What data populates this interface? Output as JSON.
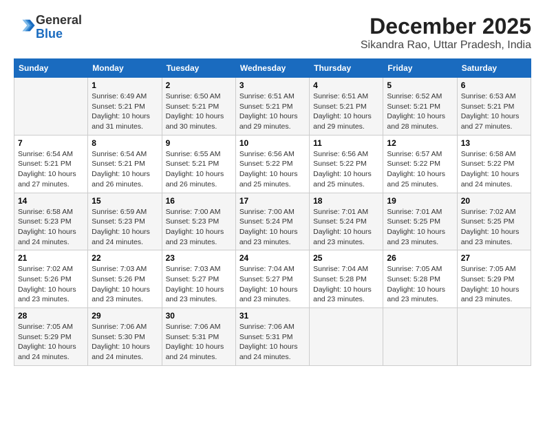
{
  "header": {
    "logo_line1": "General",
    "logo_line2": "Blue",
    "month_year": "December 2025",
    "location": "Sikandra Rao, Uttar Pradesh, India"
  },
  "days_of_week": [
    "Sunday",
    "Monday",
    "Tuesday",
    "Wednesday",
    "Thursday",
    "Friday",
    "Saturday"
  ],
  "weeks": [
    [
      {
        "day": "",
        "sunrise": "",
        "sunset": "",
        "daylight": ""
      },
      {
        "day": "1",
        "sunrise": "Sunrise: 6:49 AM",
        "sunset": "Sunset: 5:21 PM",
        "daylight": "Daylight: 10 hours and 31 minutes."
      },
      {
        "day": "2",
        "sunrise": "Sunrise: 6:50 AM",
        "sunset": "Sunset: 5:21 PM",
        "daylight": "Daylight: 10 hours and 30 minutes."
      },
      {
        "day": "3",
        "sunrise": "Sunrise: 6:51 AM",
        "sunset": "Sunset: 5:21 PM",
        "daylight": "Daylight: 10 hours and 29 minutes."
      },
      {
        "day": "4",
        "sunrise": "Sunrise: 6:51 AM",
        "sunset": "Sunset: 5:21 PM",
        "daylight": "Daylight: 10 hours and 29 minutes."
      },
      {
        "day": "5",
        "sunrise": "Sunrise: 6:52 AM",
        "sunset": "Sunset: 5:21 PM",
        "daylight": "Daylight: 10 hours and 28 minutes."
      },
      {
        "day": "6",
        "sunrise": "Sunrise: 6:53 AM",
        "sunset": "Sunset: 5:21 PM",
        "daylight": "Daylight: 10 hours and 27 minutes."
      }
    ],
    [
      {
        "day": "7",
        "sunrise": "Sunrise: 6:54 AM",
        "sunset": "Sunset: 5:21 PM",
        "daylight": "Daylight: 10 hours and 27 minutes."
      },
      {
        "day": "8",
        "sunrise": "Sunrise: 6:54 AM",
        "sunset": "Sunset: 5:21 PM",
        "daylight": "Daylight: 10 hours and 26 minutes."
      },
      {
        "day": "9",
        "sunrise": "Sunrise: 6:55 AM",
        "sunset": "Sunset: 5:21 PM",
        "daylight": "Daylight: 10 hours and 26 minutes."
      },
      {
        "day": "10",
        "sunrise": "Sunrise: 6:56 AM",
        "sunset": "Sunset: 5:22 PM",
        "daylight": "Daylight: 10 hours and 25 minutes."
      },
      {
        "day": "11",
        "sunrise": "Sunrise: 6:56 AM",
        "sunset": "Sunset: 5:22 PM",
        "daylight": "Daylight: 10 hours and 25 minutes."
      },
      {
        "day": "12",
        "sunrise": "Sunrise: 6:57 AM",
        "sunset": "Sunset: 5:22 PM",
        "daylight": "Daylight: 10 hours and 25 minutes."
      },
      {
        "day": "13",
        "sunrise": "Sunrise: 6:58 AM",
        "sunset": "Sunset: 5:22 PM",
        "daylight": "Daylight: 10 hours and 24 minutes."
      }
    ],
    [
      {
        "day": "14",
        "sunrise": "Sunrise: 6:58 AM",
        "sunset": "Sunset: 5:23 PM",
        "daylight": "Daylight: 10 hours and 24 minutes."
      },
      {
        "day": "15",
        "sunrise": "Sunrise: 6:59 AM",
        "sunset": "Sunset: 5:23 PM",
        "daylight": "Daylight: 10 hours and 24 minutes."
      },
      {
        "day": "16",
        "sunrise": "Sunrise: 7:00 AM",
        "sunset": "Sunset: 5:23 PM",
        "daylight": "Daylight: 10 hours and 23 minutes."
      },
      {
        "day": "17",
        "sunrise": "Sunrise: 7:00 AM",
        "sunset": "Sunset: 5:24 PM",
        "daylight": "Daylight: 10 hours and 23 minutes."
      },
      {
        "day": "18",
        "sunrise": "Sunrise: 7:01 AM",
        "sunset": "Sunset: 5:24 PM",
        "daylight": "Daylight: 10 hours and 23 minutes."
      },
      {
        "day": "19",
        "sunrise": "Sunrise: 7:01 AM",
        "sunset": "Sunset: 5:25 PM",
        "daylight": "Daylight: 10 hours and 23 minutes."
      },
      {
        "day": "20",
        "sunrise": "Sunrise: 7:02 AM",
        "sunset": "Sunset: 5:25 PM",
        "daylight": "Daylight: 10 hours and 23 minutes."
      }
    ],
    [
      {
        "day": "21",
        "sunrise": "Sunrise: 7:02 AM",
        "sunset": "Sunset: 5:26 PM",
        "daylight": "Daylight: 10 hours and 23 minutes."
      },
      {
        "day": "22",
        "sunrise": "Sunrise: 7:03 AM",
        "sunset": "Sunset: 5:26 PM",
        "daylight": "Daylight: 10 hours and 23 minutes."
      },
      {
        "day": "23",
        "sunrise": "Sunrise: 7:03 AM",
        "sunset": "Sunset: 5:27 PM",
        "daylight": "Daylight: 10 hours and 23 minutes."
      },
      {
        "day": "24",
        "sunrise": "Sunrise: 7:04 AM",
        "sunset": "Sunset: 5:27 PM",
        "daylight": "Daylight: 10 hours and 23 minutes."
      },
      {
        "day": "25",
        "sunrise": "Sunrise: 7:04 AM",
        "sunset": "Sunset: 5:28 PM",
        "daylight": "Daylight: 10 hours and 23 minutes."
      },
      {
        "day": "26",
        "sunrise": "Sunrise: 7:05 AM",
        "sunset": "Sunset: 5:28 PM",
        "daylight": "Daylight: 10 hours and 23 minutes."
      },
      {
        "day": "27",
        "sunrise": "Sunrise: 7:05 AM",
        "sunset": "Sunset: 5:29 PM",
        "daylight": "Daylight: 10 hours and 23 minutes."
      }
    ],
    [
      {
        "day": "28",
        "sunrise": "Sunrise: 7:05 AM",
        "sunset": "Sunset: 5:29 PM",
        "daylight": "Daylight: 10 hours and 24 minutes."
      },
      {
        "day": "29",
        "sunrise": "Sunrise: 7:06 AM",
        "sunset": "Sunset: 5:30 PM",
        "daylight": "Daylight: 10 hours and 24 minutes."
      },
      {
        "day": "30",
        "sunrise": "Sunrise: 7:06 AM",
        "sunset": "Sunset: 5:31 PM",
        "daylight": "Daylight: 10 hours and 24 minutes."
      },
      {
        "day": "31",
        "sunrise": "Sunrise: 7:06 AM",
        "sunset": "Sunset: 5:31 PM",
        "daylight": "Daylight: 10 hours and 24 minutes."
      },
      {
        "day": "",
        "sunrise": "",
        "sunset": "",
        "daylight": ""
      },
      {
        "day": "",
        "sunrise": "",
        "sunset": "",
        "daylight": ""
      },
      {
        "day": "",
        "sunrise": "",
        "sunset": "",
        "daylight": ""
      }
    ]
  ]
}
